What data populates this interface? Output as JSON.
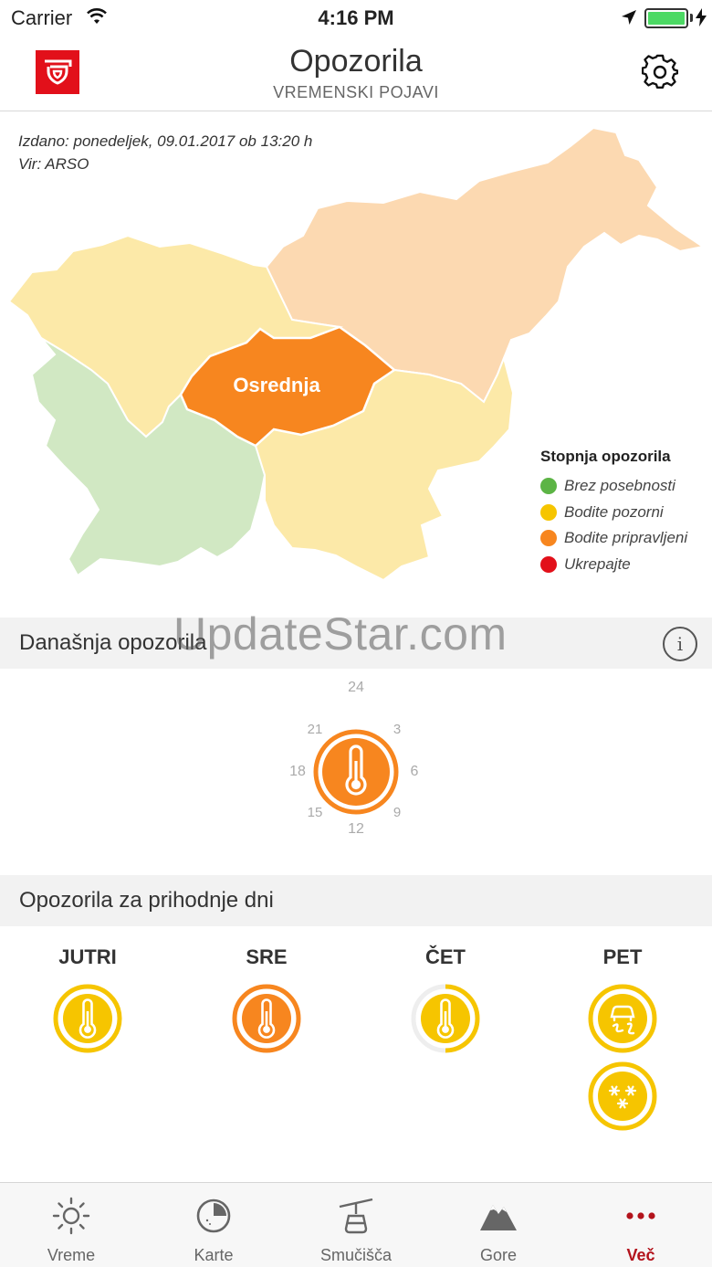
{
  "status_bar": {
    "carrier": "Carrier",
    "time": "4:16 PM"
  },
  "header": {
    "title": "Opozorila",
    "subtitle": "VREMENSKI POJAVI"
  },
  "map": {
    "issued": "Izdano: ponedeljek, 09.01.2017 ob 13:20 h",
    "source": "Vir: ARSO",
    "region_label": "Osrednja",
    "legend_title": "Stopnja opozorila",
    "legend": [
      {
        "label": "Brez posebnosti",
        "color": "#5cb445"
      },
      {
        "label": "Bodite pozorni",
        "color": "#f6c500"
      },
      {
        "label": "Bodite pripravljeni",
        "color": "#f7861f"
      },
      {
        "label": "Ukrepajte",
        "color": "#e2101a"
      }
    ]
  },
  "today": {
    "title": "Današnja opozorila",
    "clock_numbers": [
      "24",
      "3",
      "6",
      "9",
      "12",
      "15",
      "18",
      "21"
    ],
    "icon": "thermometer-icon",
    "level_color": "#f7861f"
  },
  "watermark": "UpdateStar.com",
  "upcoming": {
    "title": "Opozorila za prihodnje dni",
    "days": [
      {
        "label": "JUTRI",
        "icons": [
          "thermometer-icon"
        ],
        "color": "#f6c500"
      },
      {
        "label": "SRE",
        "icons": [
          "thermometer-icon"
        ],
        "color": "#f7861f"
      },
      {
        "label": "ČET",
        "icons": [
          "thermometer-icon"
        ],
        "color": "#f6c500"
      },
      {
        "label": "PET",
        "icons": [
          "slippery-road-icon",
          "snow-icon"
        ],
        "color": "#f6c500"
      }
    ]
  },
  "tabs": [
    {
      "label": "Vreme",
      "icon": "sun-icon"
    },
    {
      "label": "Karte",
      "icon": "radar-icon"
    },
    {
      "label": "Smučišča",
      "icon": "cable-car-icon"
    },
    {
      "label": "Gore",
      "icon": "mountain-icon"
    },
    {
      "label": "Več",
      "icon": "more-icon",
      "active": true
    }
  ]
}
